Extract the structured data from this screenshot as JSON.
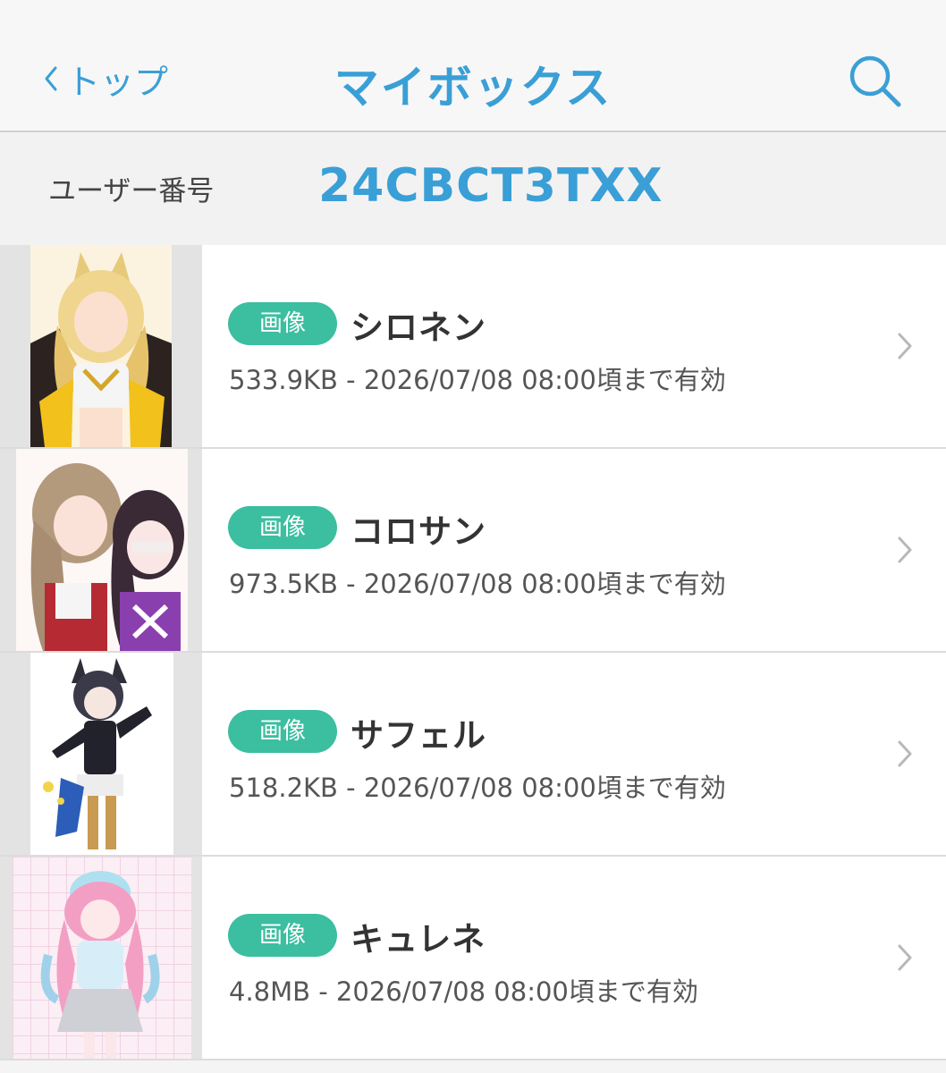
{
  "header": {
    "back_label": "トップ",
    "title": "マイボックス",
    "back_icon": "chevron-left-icon",
    "search_icon": "search-icon"
  },
  "user": {
    "label": "ユーザー番号",
    "id": "24CBCT3TXX"
  },
  "items": [
    {
      "badge": "画像",
      "title": "シロネン",
      "meta": "533.9KB - 2026/07/08 08:00頃まで有効"
    },
    {
      "badge": "画像",
      "title": "コロサン",
      "meta": "973.5KB - 2026/07/08 08:00頃まで有効"
    },
    {
      "badge": "画像",
      "title": "サフェル",
      "meta": "518.2KB - 2026/07/08 08:00頃まで有効"
    },
    {
      "badge": "画像",
      "title": "キュレネ",
      "meta": "4.8MB - 2026/07/08 08:00頃まで有効"
    }
  ],
  "colors": {
    "accent": "#3a9fd6",
    "badge": "#3cbea0"
  }
}
